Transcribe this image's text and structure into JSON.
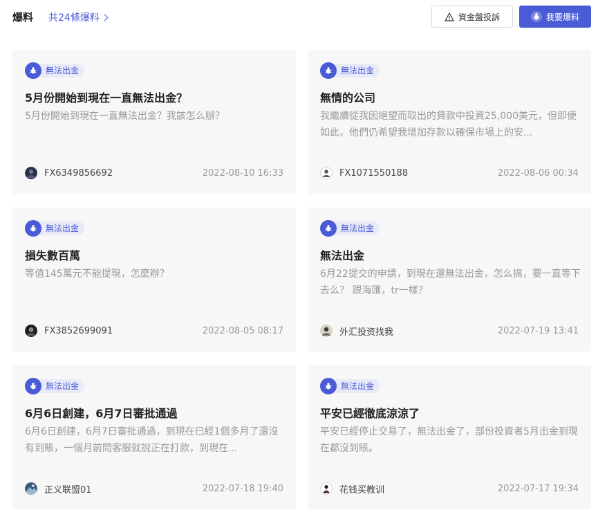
{
  "header": {
    "title": "爆料",
    "count_label": "共24條爆料",
    "complaint_button": "資金盤投訴",
    "report_button": "我要爆料"
  },
  "colors": {
    "accent": "#4a5bd6",
    "tag_bg": "#e8eaf8",
    "card_bg": "#f7f7f8",
    "muted": "#999999"
  },
  "cards": [
    {
      "tag": "無法出金",
      "title": "5月份開始到現在一直無法出金？",
      "body": "5月份開始到現在一直無法出金？我該怎么辦？",
      "user": "FX6349856692",
      "date": "2022-08-10 16:33",
      "avatar": "dark-avatar"
    },
    {
      "tag": "無法出金",
      "title": "無情的公司",
      "body": "我繼續從我因絕望而取出的貸款中投資25,000美元，但即便如此，他們仍希望我增加存款以確保市場上的安...",
      "user": "FX1071550188",
      "date": "2022-08-06 00:34",
      "avatar": "default-avatar"
    },
    {
      "tag": "無法出金",
      "title": "損失數百萬",
      "body": "等值145萬元不能提現，怎麼辦？",
      "user": "FX3852699091",
      "date": "2022-08-05 08:17",
      "avatar": "dark-avatar"
    },
    {
      "tag": "無法出金",
      "title": "無法出金",
      "body": "6月22提交的申請，到現在還無法出金，怎么搞，要一直等下去么？ 跟海匯，tr一樣？",
      "user": "外汇投资找我",
      "date": "2022-07-19 13:41",
      "avatar": "photo-avatar"
    },
    {
      "tag": "無法出金",
      "title": "6月6日創建，6月7日審批通過",
      "body": "6月6日創建，6月7日審批通過，到現在已經1個多月了還沒有到賬，一個月前問客服就說正在打款，到現在...",
      "user": "正义联盟01",
      "date": "2022-07-18 19:40",
      "avatar": "photo-avatar"
    },
    {
      "tag": "無法出金",
      "title": "平安已經徹底涼涼了",
      "body": "平安已經停止交易了，無法出金了，部份投資者5月出金到現在都沒到賬。",
      "user": "花钱买教训",
      "date": "2022-07-17 19:34",
      "avatar": "person-avatar"
    }
  ]
}
